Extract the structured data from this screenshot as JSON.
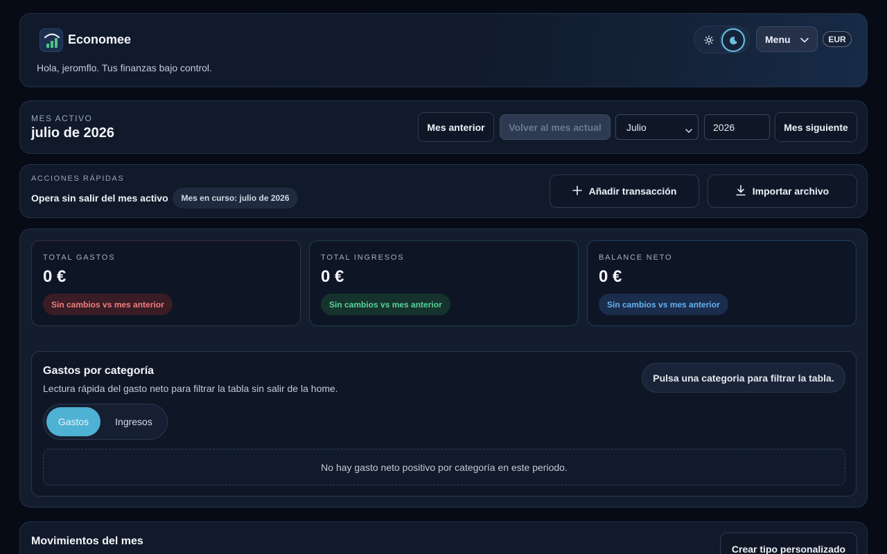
{
  "header": {
    "brand": "Economee",
    "greeting": "Hola, jeromflo. Tus finanzas bajo control.",
    "menu_label": "Menu",
    "currency": "EUR",
    "theme_icons": [
      "sun-icon",
      "moon-icon"
    ]
  },
  "month_nav": {
    "eyebrow": "MES ACTIVO",
    "title": "julio de 2026",
    "prev_label": "Mes anterior",
    "current_label": "Volver al mes actual",
    "month_value": "Julio",
    "year_value": "2026",
    "next_label": "Mes siguiente"
  },
  "quick_actions": {
    "eyebrow": "ACCIONES RÁPIDAS",
    "label": "Opera sin salir del mes activo",
    "pill": "Mes en curso: julio de 2026",
    "add_label": "Añadir transacción",
    "import_label": "Importar archivo"
  },
  "stats": [
    {
      "eyebrow": "TOTAL GASTOS",
      "value": "0 €",
      "badge": "Sin cambios vs mes anterior"
    },
    {
      "eyebrow": "TOTAL INGRESOS",
      "value": "0 €",
      "badge": "Sin cambios vs mes anterior"
    },
    {
      "eyebrow": "BALANCE NETO",
      "value": "0 €",
      "badge": "Sin cambios vs mes anterior"
    }
  ],
  "categories": {
    "title": "Gastos por categoría",
    "description": "Lectura rápida del gasto neto para filtrar la tabla sin salir de la home.",
    "hint": "Pulsa una categoria para filtrar la tabla.",
    "tab_expenses": "Gastos",
    "tab_income": "Ingresos",
    "empty": "No hay gasto neto positivo por categoría en este periodo."
  },
  "movements": {
    "title": "Movimientos del mes",
    "custom_type_label": "Crear tipo personalizado"
  },
  "colors": {
    "accent": "#4fb1d3",
    "expense_badge_bg": "#3a1c25",
    "expense_badge_text": "#f07f7f",
    "income_badge_bg": "#15332c",
    "income_badge_text": "#59d39a",
    "balance_badge_bg": "#1a2d4c",
    "balance_badge_text": "#66b3f0"
  }
}
